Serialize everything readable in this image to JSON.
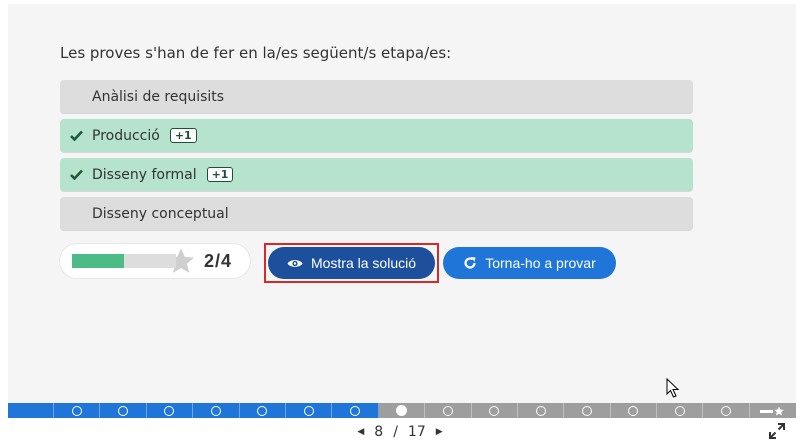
{
  "question": "Les proves s'han de fer en la/es següent/s etapa/es:",
  "options": [
    {
      "label": "Anàlisi de requisits",
      "state": "neutral",
      "badge": ""
    },
    {
      "label": "Producció",
      "state": "correct",
      "badge": "+1"
    },
    {
      "label": "Disseny formal",
      "state": "correct",
      "badge": "+1"
    },
    {
      "label": "Disseny conceptual",
      "state": "neutral",
      "badge": ""
    }
  ],
  "score": {
    "text": "2/4",
    "earned": 2,
    "max": 4
  },
  "buttons": {
    "show_solution": "Mostra la solució",
    "retry": "Torna-ho a provar"
  },
  "navigation": {
    "current": "8",
    "separator": "/",
    "total": "17",
    "current_index": 8,
    "total_count": 17
  },
  "colors": {
    "correct_bg": "#b5e3cd",
    "neutral_bg": "#dddddd",
    "primary_dark": "#1c4f9c",
    "primary": "#1f75d8",
    "score_fill": "#4dbb86",
    "highlight": "#d62a2a"
  },
  "icons": {
    "check": "check-icon",
    "star": "star-icon",
    "eye": "eye-icon",
    "retry": "retry-icon",
    "fullscreen": "fullscreen-icon"
  }
}
